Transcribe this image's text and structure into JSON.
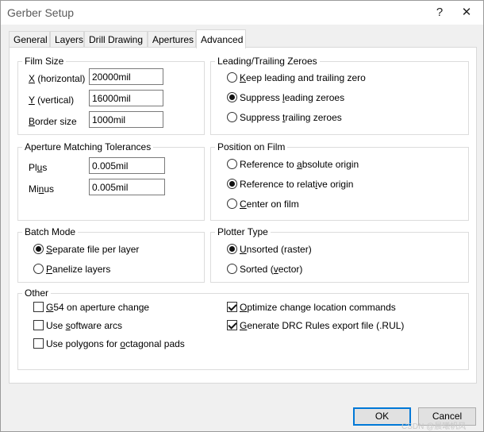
{
  "window": {
    "title": "Gerber Setup",
    "help_glyph": "?",
    "close_glyph": "✕"
  },
  "tabs": [
    "General",
    "Layers",
    "Drill Drawing",
    "Apertures",
    "Advanced"
  ],
  "film_size": {
    "legend": "Film Size",
    "x_label_u": "X",
    "x_label_rest": " (horizontal)",
    "x_value": "20000mil",
    "y_label_u": "Y",
    "y_label_rest": " (vertical)",
    "y_value": "16000mil",
    "border_label_u": "B",
    "border_label_rest": "order size",
    "border_value": "1000mil"
  },
  "zeroes": {
    "legend": "Leading/Trailing Zeroes",
    "opt1_u": "K",
    "opt1_rest": "eep leading and trailing zero",
    "opt2_pre": "Suppress ",
    "opt2_u": "l",
    "opt2_rest": "eading zeroes",
    "opt3_pre": "Suppress ",
    "opt3_u": "t",
    "opt3_rest": "railing zeroes",
    "selected": 2
  },
  "aperture_tol": {
    "legend": "Aperture Matching Tolerances",
    "plus_pre": "Pl",
    "plus_u": "u",
    "plus_rest": "s",
    "plus_value": "0.005mil",
    "minus_pre": "Mi",
    "minus_u": "n",
    "minus_rest": "us",
    "minus_value": "0.005mil"
  },
  "position": {
    "legend": "Position on Film",
    "opt1_pre": "Reference to ",
    "opt1_u": "a",
    "opt1_rest": "bsolute origin",
    "opt2_pre": "Reference to relat",
    "opt2_u": "i",
    "opt2_rest": "ve origin",
    "opt3_u": "C",
    "opt3_rest": "enter on film",
    "selected": 2
  },
  "batch": {
    "legend": "Batch Mode",
    "opt1_u": "S",
    "opt1_rest": "eparate file per layer",
    "opt2_u": "P",
    "opt2_rest": "anelize layers",
    "selected": 1
  },
  "plotter": {
    "legend": "Plotter Type",
    "opt1_u": "U",
    "opt1_rest": "nsorted (raster)",
    "opt2_pre": "Sorted (",
    "opt2_u": "v",
    "opt2_rest": "ector)",
    "selected": 1
  },
  "other": {
    "legend": "Other",
    "g54_u": "G",
    "g54_rest": "54 on aperture change",
    "g54_checked": false,
    "arcs_pre": "Use ",
    "arcs_u": "s",
    "arcs_rest": "oftware arcs",
    "arcs_checked": false,
    "poly_pre": "Use polygons for ",
    "poly_u": "o",
    "poly_rest": "ctagonal pads",
    "poly_checked": false,
    "opt_u": "O",
    "opt_rest": "ptimize change location commands",
    "opt_checked": true,
    "drc_u": "G",
    "drc_rest": "enerate DRC Rules export file (.RUL)",
    "drc_checked": true
  },
  "buttons": {
    "ok": "OK",
    "cancel": "Cancel"
  },
  "watermark": "CSDN @晨曦帆风"
}
